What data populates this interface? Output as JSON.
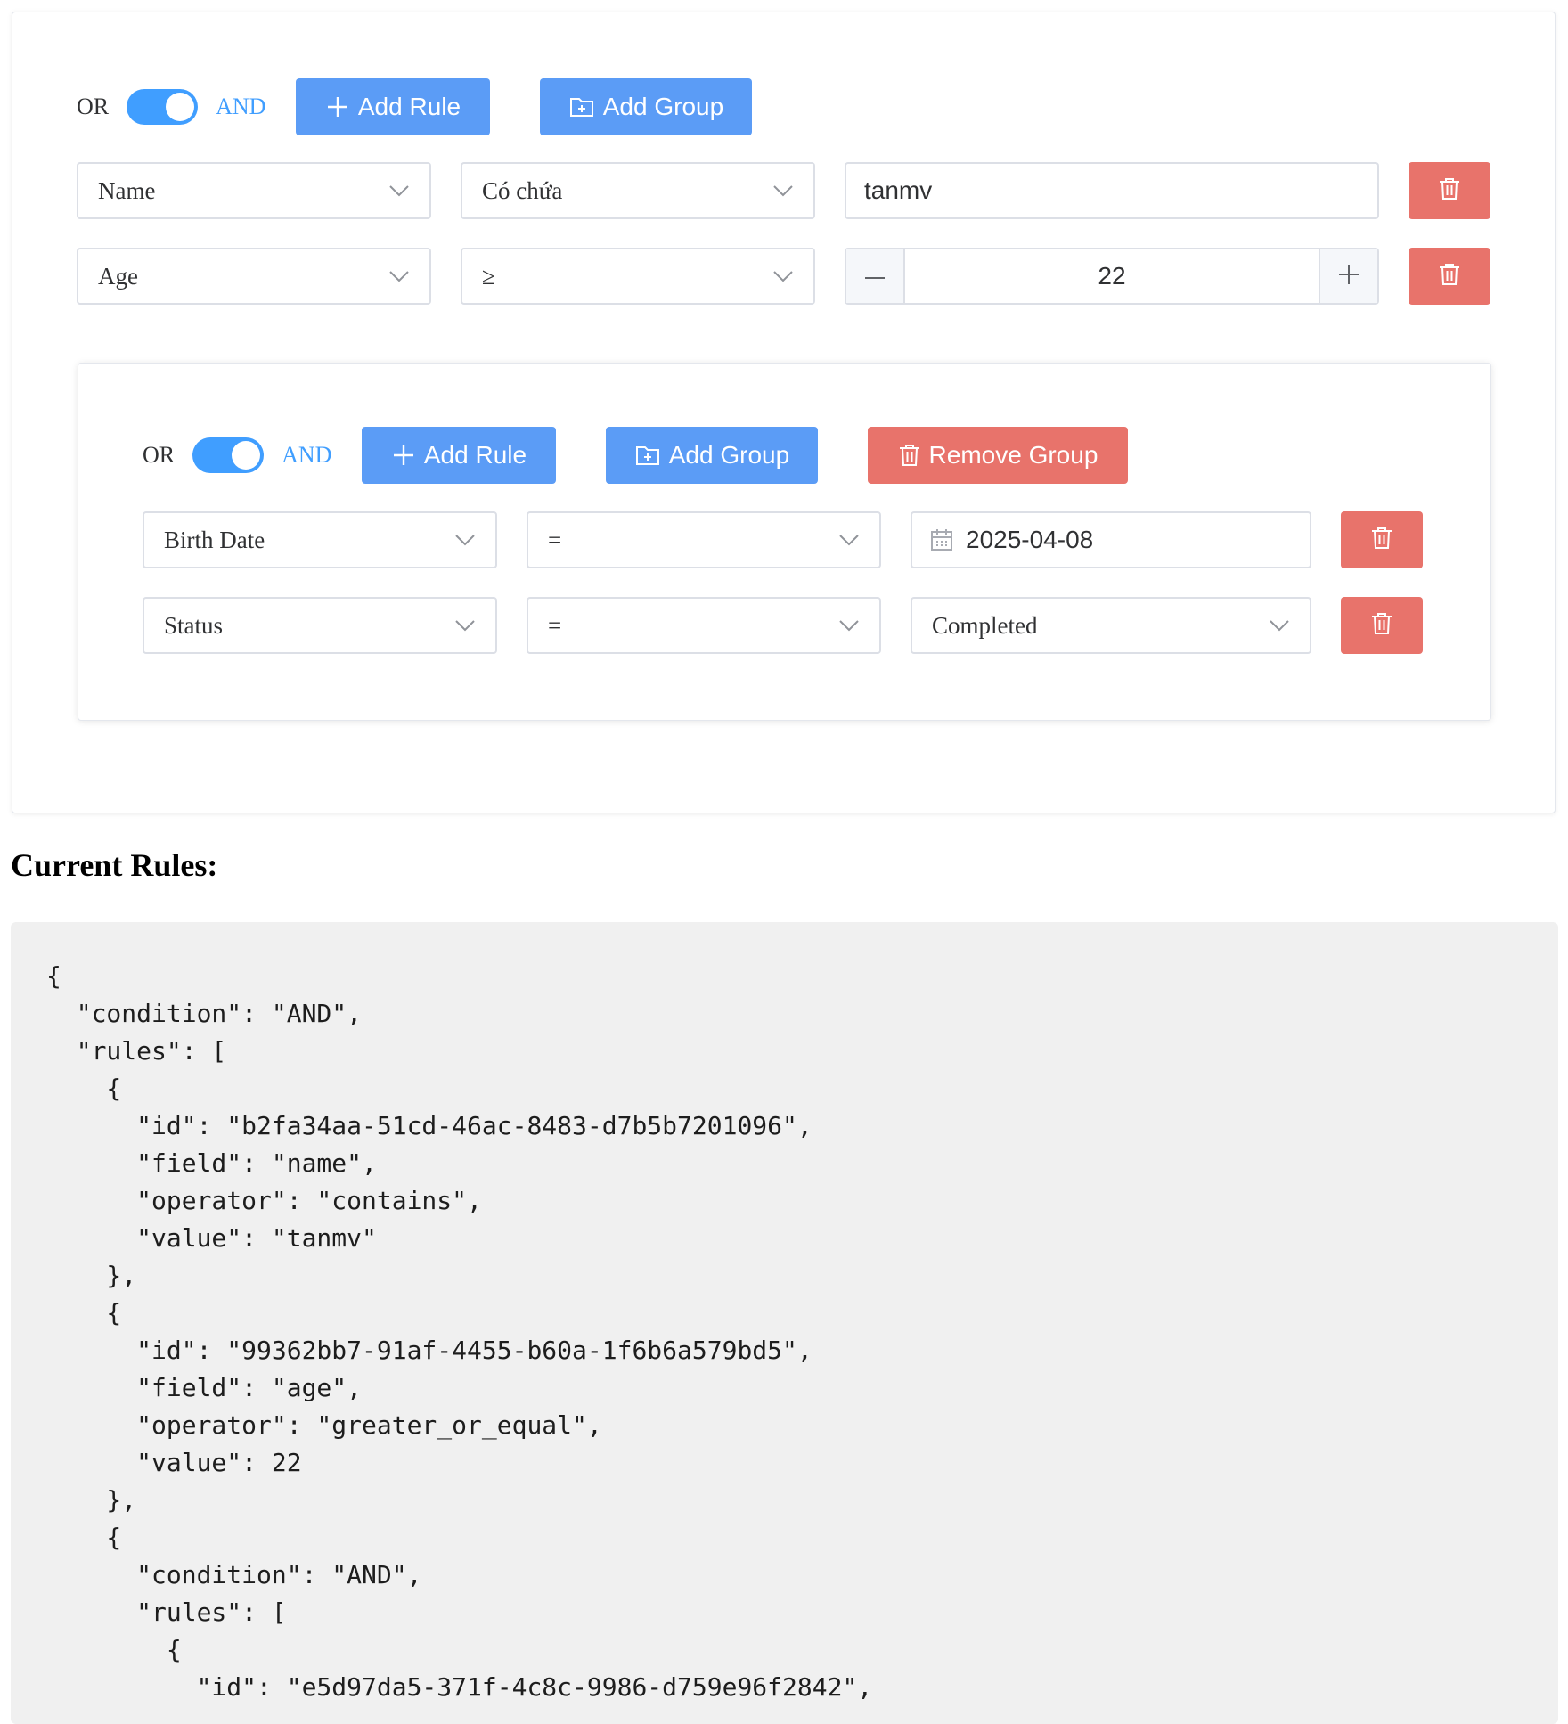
{
  "outer_group": {
    "toggle": {
      "or_label": "OR",
      "and_label": "AND",
      "value": "AND"
    },
    "add_rule_label": "Add Rule",
    "add_group_label": "Add Group",
    "rules": [
      {
        "field": "Name",
        "operator": "Có chứa",
        "value": "tanmv"
      },
      {
        "field": "Age",
        "operator": "≥",
        "value": "22",
        "minus": "—",
        "plus": "+"
      }
    ]
  },
  "inner_group": {
    "toggle": {
      "or_label": "OR",
      "and_label": "AND",
      "value": "AND"
    },
    "add_rule_label": "Add Rule",
    "add_group_label": "Add Group",
    "remove_group_label": "Remove Group",
    "rules": [
      {
        "field": "Birth Date",
        "operator": "=",
        "value": "2025-04-08"
      },
      {
        "field": "Status",
        "operator": "=",
        "value": "Completed"
      }
    ]
  },
  "current_rules_title": "Current Rules:",
  "current_rules_json": "{\n  \"condition\": \"AND\",\n  \"rules\": [\n    {\n      \"id\": \"b2fa34aa-51cd-46ac-8483-d7b5b7201096\",\n      \"field\": \"name\",\n      \"operator\": \"contains\",\n      \"value\": \"tanmv\"\n    },\n    {\n      \"id\": \"99362bb7-91af-4455-b60a-1f6b6a579bd5\",\n      \"field\": \"age\",\n      \"operator\": \"greater_or_equal\",\n      \"value\": 22\n    },\n    {\n      \"condition\": \"AND\",\n      \"rules\": [\n        {\n          \"id\": \"e5d97da5-371f-4c8c-9986-d759e96f2842\",",
  "colors": {
    "primary": "#5b9cf6",
    "danger": "#e8736b",
    "toggle_on": "#409eff"
  }
}
